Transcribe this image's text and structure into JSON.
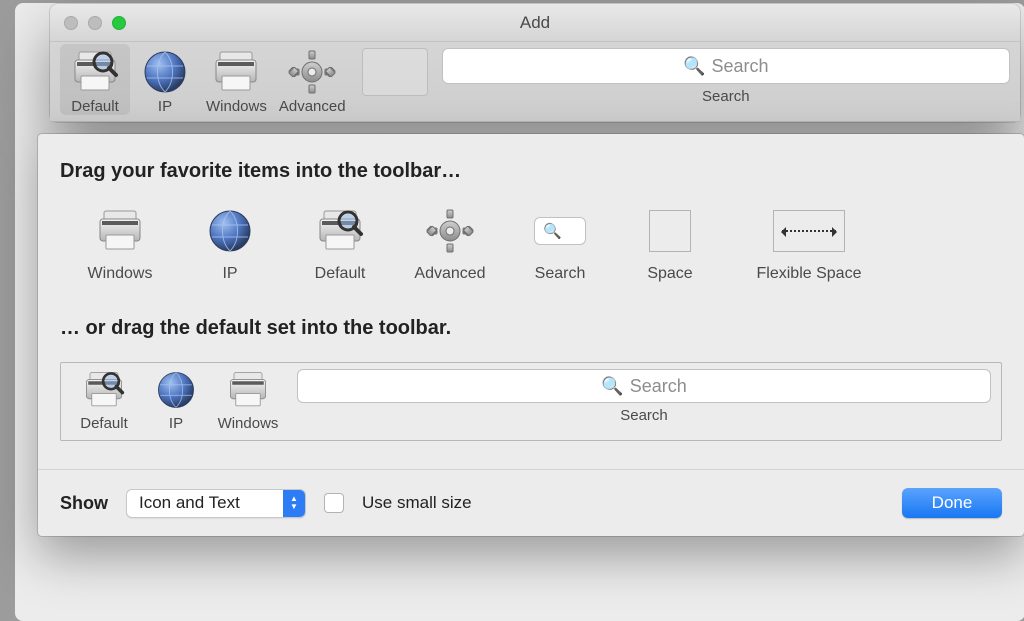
{
  "titlebar": {
    "title": "Add"
  },
  "toolbar": {
    "items": [
      {
        "label": "Default"
      },
      {
        "label": "IP"
      },
      {
        "label": "Windows"
      },
      {
        "label": "Advanced"
      }
    ],
    "search_placeholder": "Search",
    "search_caption": "Search"
  },
  "sheet": {
    "h1": "Drag your favorite items into the toolbar…",
    "palette": [
      {
        "label": "Windows"
      },
      {
        "label": "IP"
      },
      {
        "label": "Default"
      },
      {
        "label": "Advanced"
      },
      {
        "label": "Search"
      },
      {
        "label": "Space"
      },
      {
        "label": "Flexible Space"
      }
    ],
    "h2": "… or drag the default set into the toolbar.",
    "default_set": {
      "items": [
        {
          "label": "Default"
        },
        {
          "label": "IP"
        },
        {
          "label": "Windows"
        }
      ],
      "search_placeholder": "Search",
      "search_caption": "Search"
    },
    "footer": {
      "show_label": "Show",
      "show_value": "Icon and Text",
      "small_size_label": "Use small size",
      "done_label": "Done"
    }
  }
}
